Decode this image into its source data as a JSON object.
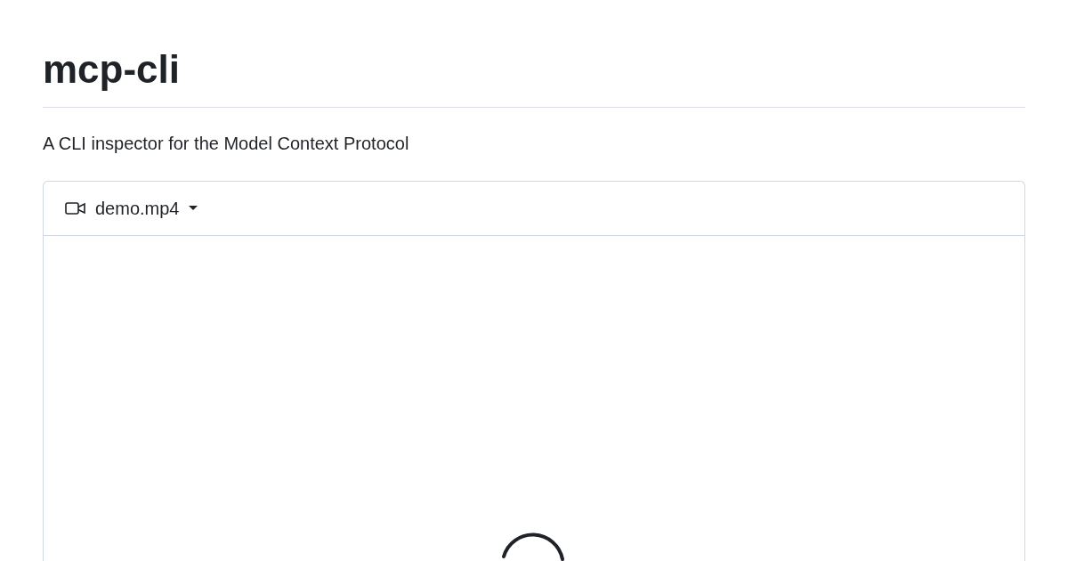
{
  "title": "mcp-cli",
  "description": "A CLI inspector for the Model Context Protocol",
  "media": {
    "file_name": "demo.mp4"
  }
}
